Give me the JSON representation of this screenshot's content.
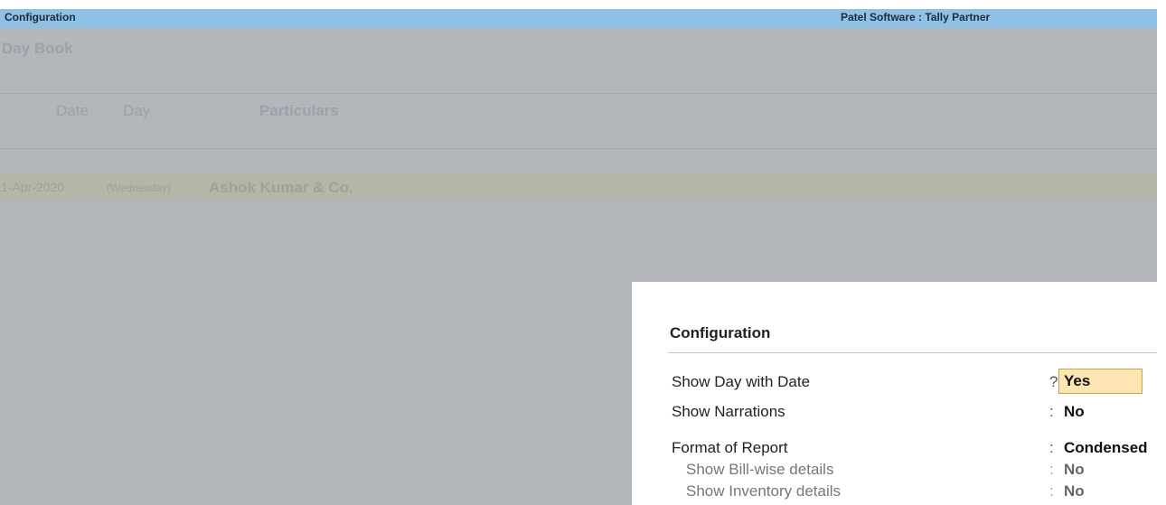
{
  "titlebar": {
    "left": "Configuration",
    "right": "Patel Software : Tally Partner"
  },
  "report": {
    "title": "Day Book",
    "columns": {
      "date": "Date",
      "day": "Day",
      "particulars": "Particulars"
    },
    "entry": {
      "date": "1-Apr-2020",
      "day": "(Wednesday)",
      "party": "Ashok Kumar & Co."
    }
  },
  "dialog": {
    "title": "Configuration",
    "options": [
      {
        "label": "Show Day with Date",
        "sep": "?",
        "value": "Yes"
      },
      {
        "label": "Show Narrations",
        "sep": ":",
        "value": "No"
      },
      {
        "label": "Format of Report",
        "sep": ":",
        "value": "Condensed"
      },
      {
        "label": "Show Bill-wise details",
        "sep": ":",
        "value": "No"
      },
      {
        "label": "Show Inventory details",
        "sep": ":",
        "value": "No"
      }
    ]
  }
}
